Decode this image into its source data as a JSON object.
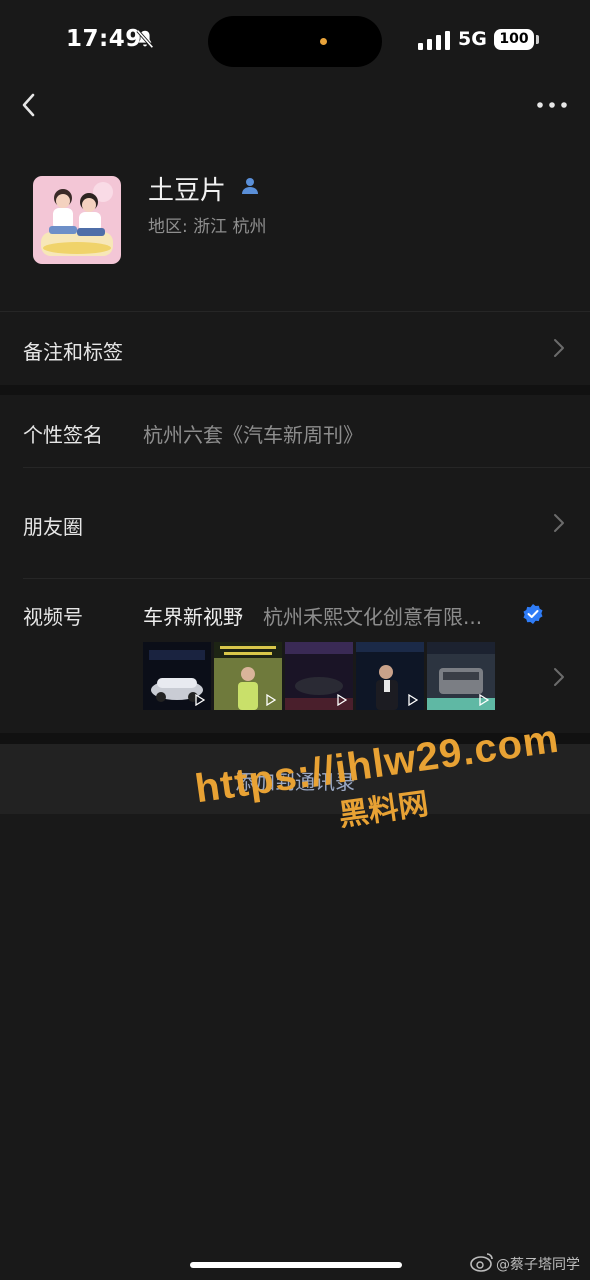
{
  "status_bar": {
    "time": "17:49",
    "network": "5G",
    "battery": "100"
  },
  "profile": {
    "name": "土豆片",
    "region": "地区: 浙江 杭州"
  },
  "rows": {
    "remark_label": "备注和标签",
    "signature_label": "个性签名",
    "signature_value": "杭州六套《汽车新周刊》",
    "moments_label": "朋友圈",
    "channels_label": "视频号",
    "channel_name": "车界新视野",
    "channel_company": "杭州禾熙文化创意有限..."
  },
  "actions": {
    "add_contact": "添加到通讯录"
  },
  "watermark": {
    "url": "https://ihlw29.com",
    "site": "黑料网"
  },
  "corner_mark": "@蔡子塔同学",
  "colors": {
    "background": "#191919",
    "accent_link": "#9aa8c4",
    "verified_blue": "#2f7cf6",
    "watermark": "#e8a234"
  }
}
